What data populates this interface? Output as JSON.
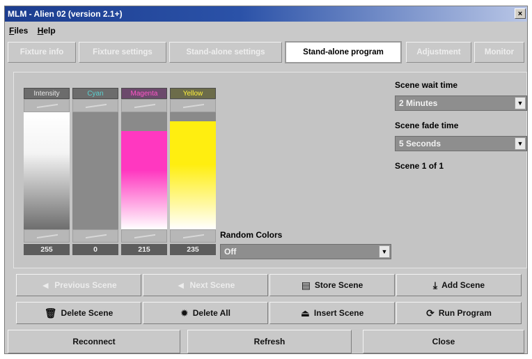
{
  "window": {
    "title": "MLM - Alien 02 (version 2.1+)",
    "close_glyph": "×"
  },
  "menu": {
    "files": {
      "ul": "F",
      "rest": "iles"
    },
    "help": {
      "ul": "H",
      "rest": "elp"
    }
  },
  "tabs": [
    {
      "label": "Fixture info",
      "active": false
    },
    {
      "label": "Fixture settings",
      "active": false
    },
    {
      "label": "Stand-alone settings",
      "active": false
    },
    {
      "label": "Stand-alone program",
      "active": true
    },
    {
      "label": "Adjustment",
      "active": false
    },
    {
      "label": "Monitor",
      "active": false
    }
  ],
  "sliders": [
    {
      "label": "Intensity",
      "value": "255",
      "fill_fraction": 1.0,
      "color": "#ffffff"
    },
    {
      "label": "Cyan",
      "value": "0",
      "fill_fraction": 0.0,
      "color": "#00c8c8"
    },
    {
      "label": "Magenta",
      "value": "215",
      "fill_fraction": 0.84,
      "color": "#ff38c0"
    },
    {
      "label": "Yellow",
      "value": "235",
      "fill_fraction": 0.92,
      "color": "#ffee10"
    }
  ],
  "random_colors": {
    "label": "Random Colors",
    "value": "Off"
  },
  "scene_wait": {
    "label": "Scene wait time",
    "value": "2 Minutes"
  },
  "scene_fade": {
    "label": "Scene fade time",
    "value": "5 Seconds"
  },
  "scene_counter": "Scene 1 of 1",
  "buttons": {
    "previous_scene": {
      "label": "Previous Scene",
      "icon": "◄",
      "enabled": false
    },
    "next_scene": {
      "label": "Next Scene",
      "icon": "◄",
      "enabled": false
    },
    "store_scene": {
      "label": "Store Scene",
      "icon": "▤",
      "enabled": true
    },
    "add_scene": {
      "label": "Add Scene",
      "icon": "⤓",
      "enabled": true
    },
    "delete_scene": {
      "label": "Delete Scene",
      "icon": "🗑",
      "enabled": true
    },
    "delete_all": {
      "label": "Delete All",
      "icon": "✹",
      "enabled": true
    },
    "insert_scene": {
      "label": "Insert Scene",
      "icon": "⏏",
      "enabled": true
    },
    "run_program": {
      "label": "Run Program",
      "icon": "⟳",
      "enabled": true
    }
  },
  "footer": {
    "reconnect": "Reconnect",
    "refresh": "Refresh",
    "close": "Close"
  },
  "colors": {
    "title_bar": "#1c3d8f",
    "window_bg": "#c9c9c9"
  }
}
